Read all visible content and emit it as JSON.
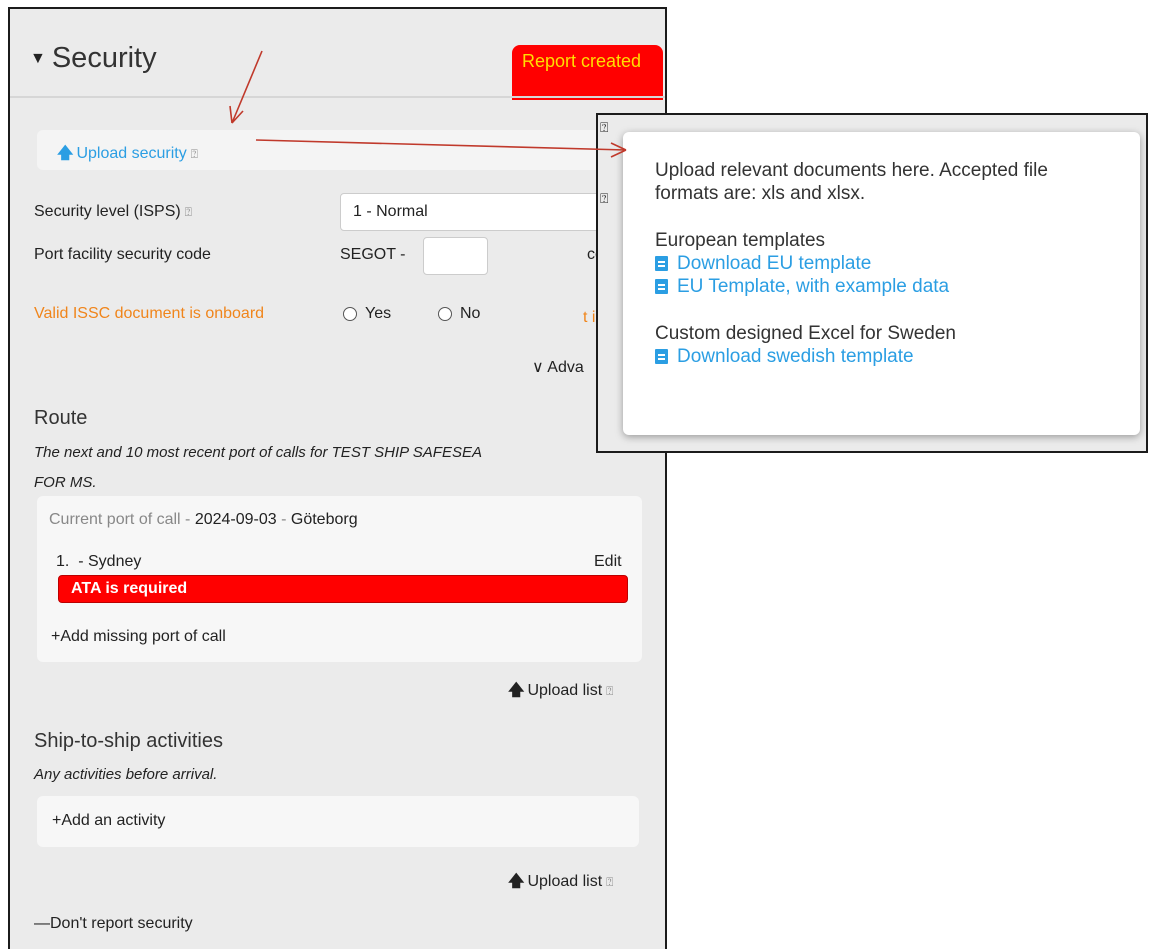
{
  "header": {
    "title": "Security",
    "badge": "Report created"
  },
  "upload": {
    "label": "Upload security",
    "help": "?"
  },
  "fields": {
    "security_level_label": "Security level (ISPS)",
    "security_level_value": "1 - Normal",
    "pfsc_label": "Port facility security code",
    "pfsc_prefix": "SEGOT -",
    "issc_label": "Valid ISSC document is onboard",
    "yes": "Yes",
    "no": "No",
    "advanced": "Adva",
    "clipped_code": "co",
    "clipped_t": "t is"
  },
  "route": {
    "title": "Route",
    "desc_line1": "The next and 10 most recent port of calls for TEST SHIP SAFESEA",
    "desc_line2": "FOR MS.",
    "current_label": "Current port of call - ",
    "current_date": "2024-09-03",
    "current_sep": " - ",
    "current_port": "Göteborg",
    "item_number": "1.",
    "item_port": "- Sydney",
    "edit": "Edit",
    "error": "ATA is required",
    "add_missing": "Add missing port of call",
    "upload_list": "Upload list"
  },
  "sts": {
    "title": "Ship-to-ship activities",
    "desc": "Any activities before arrival.",
    "add_activity": "Add an activity",
    "upload_list": "Upload list"
  },
  "footer": {
    "dont_report": "Don't report security"
  },
  "popup": {
    "intro": "Upload relevant documents here. Accepted file formats are: xls and xlsx.",
    "eu_heading": "European templates",
    "eu_download": "Download EU template",
    "eu_example": "EU Template, with example data",
    "se_heading": "Custom designed Excel for Sweden",
    "se_download": "Download swedish template"
  },
  "colors": {
    "accent": "#2b9ee3",
    "error": "#ff0000",
    "warning": "#f0851b",
    "badge_text": "#ffdf00",
    "arrow": "#c0392b"
  }
}
